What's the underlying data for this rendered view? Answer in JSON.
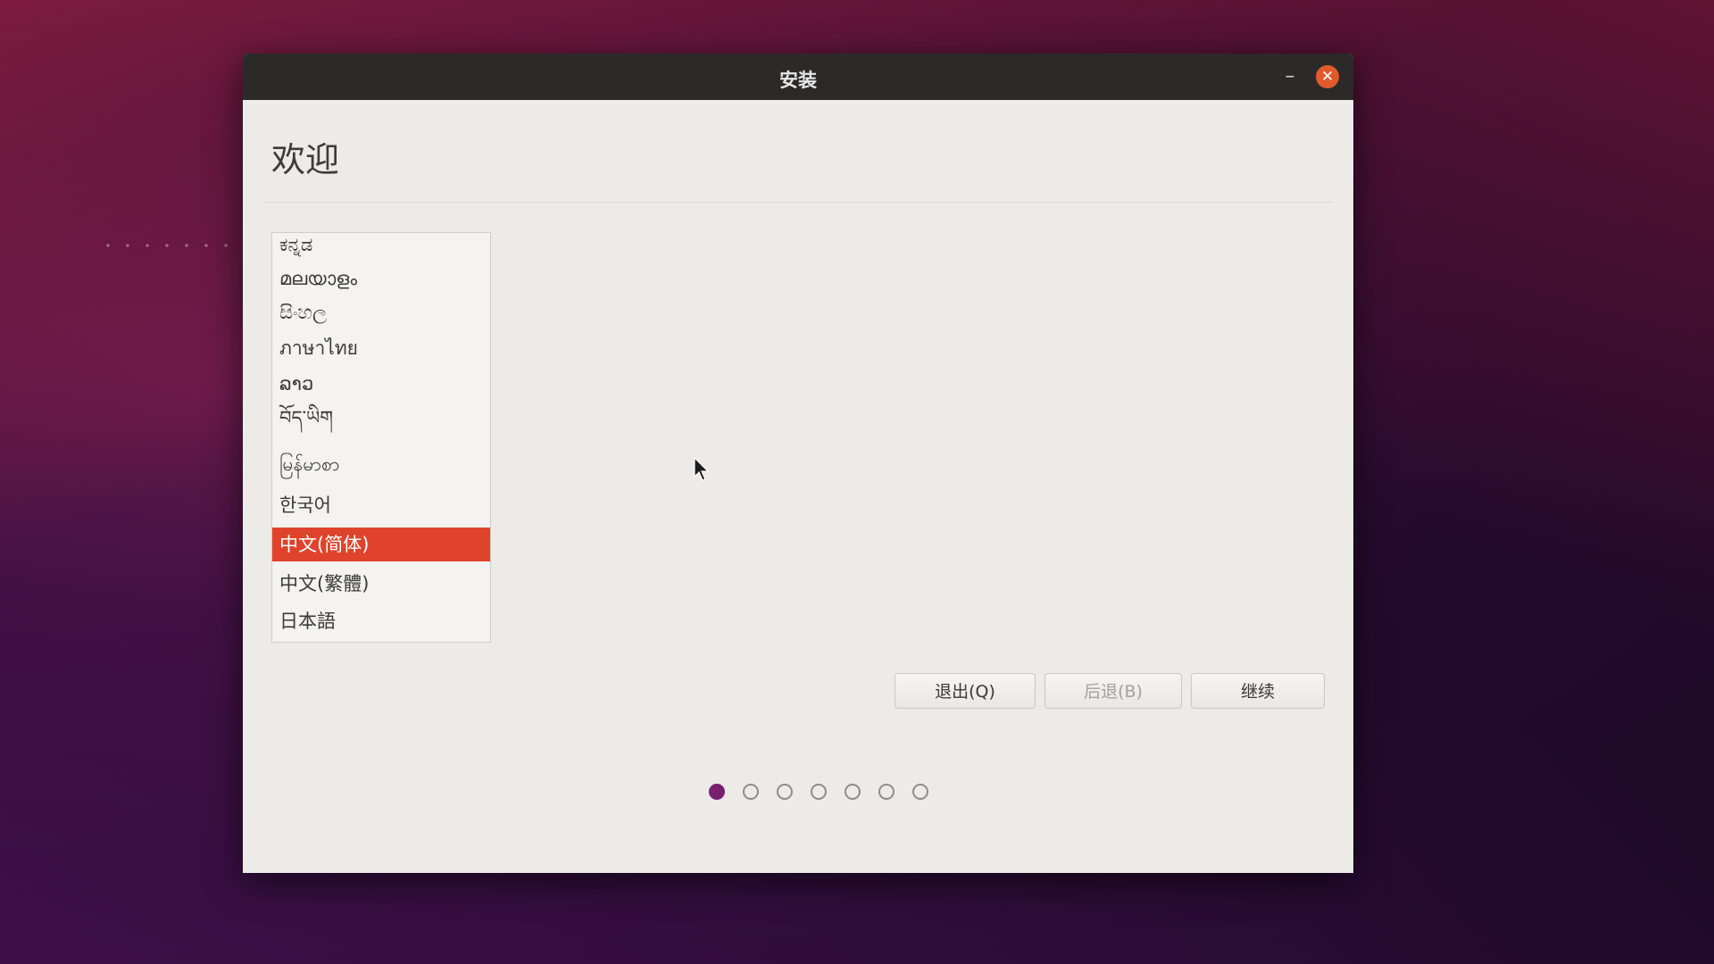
{
  "window": {
    "title": "安装",
    "minimize_glyph": "–",
    "close_glyph": "✕"
  },
  "page": {
    "title": "欢迎"
  },
  "languages": [
    {
      "label": "ಕನ್ನಡ",
      "selected": false
    },
    {
      "label": "മലയാളം",
      "selected": false
    },
    {
      "label": "සිංහල",
      "selected": false
    },
    {
      "label": "ภาษาไทย",
      "selected": false
    },
    {
      "label": "ລາວ",
      "selected": false
    },
    {
      "label": "བོད་ཡིག",
      "selected": false
    },
    {
      "label": "မြန်မာစာ",
      "selected": false
    },
    {
      "label": "한국어",
      "selected": false
    },
    {
      "label": "中文(简体)",
      "selected": true
    },
    {
      "label": "中文(繁體)",
      "selected": false
    },
    {
      "label": "日本語",
      "selected": false
    }
  ],
  "buttons": {
    "quit": "退出(Q)",
    "back": "后退(B)",
    "continue": "继续"
  },
  "progress": {
    "total_steps": 7,
    "current_step": 1
  },
  "colors": {
    "accent_selected": "#e0432c",
    "close_button": "#e05a2c",
    "active_step": "#77216f"
  }
}
